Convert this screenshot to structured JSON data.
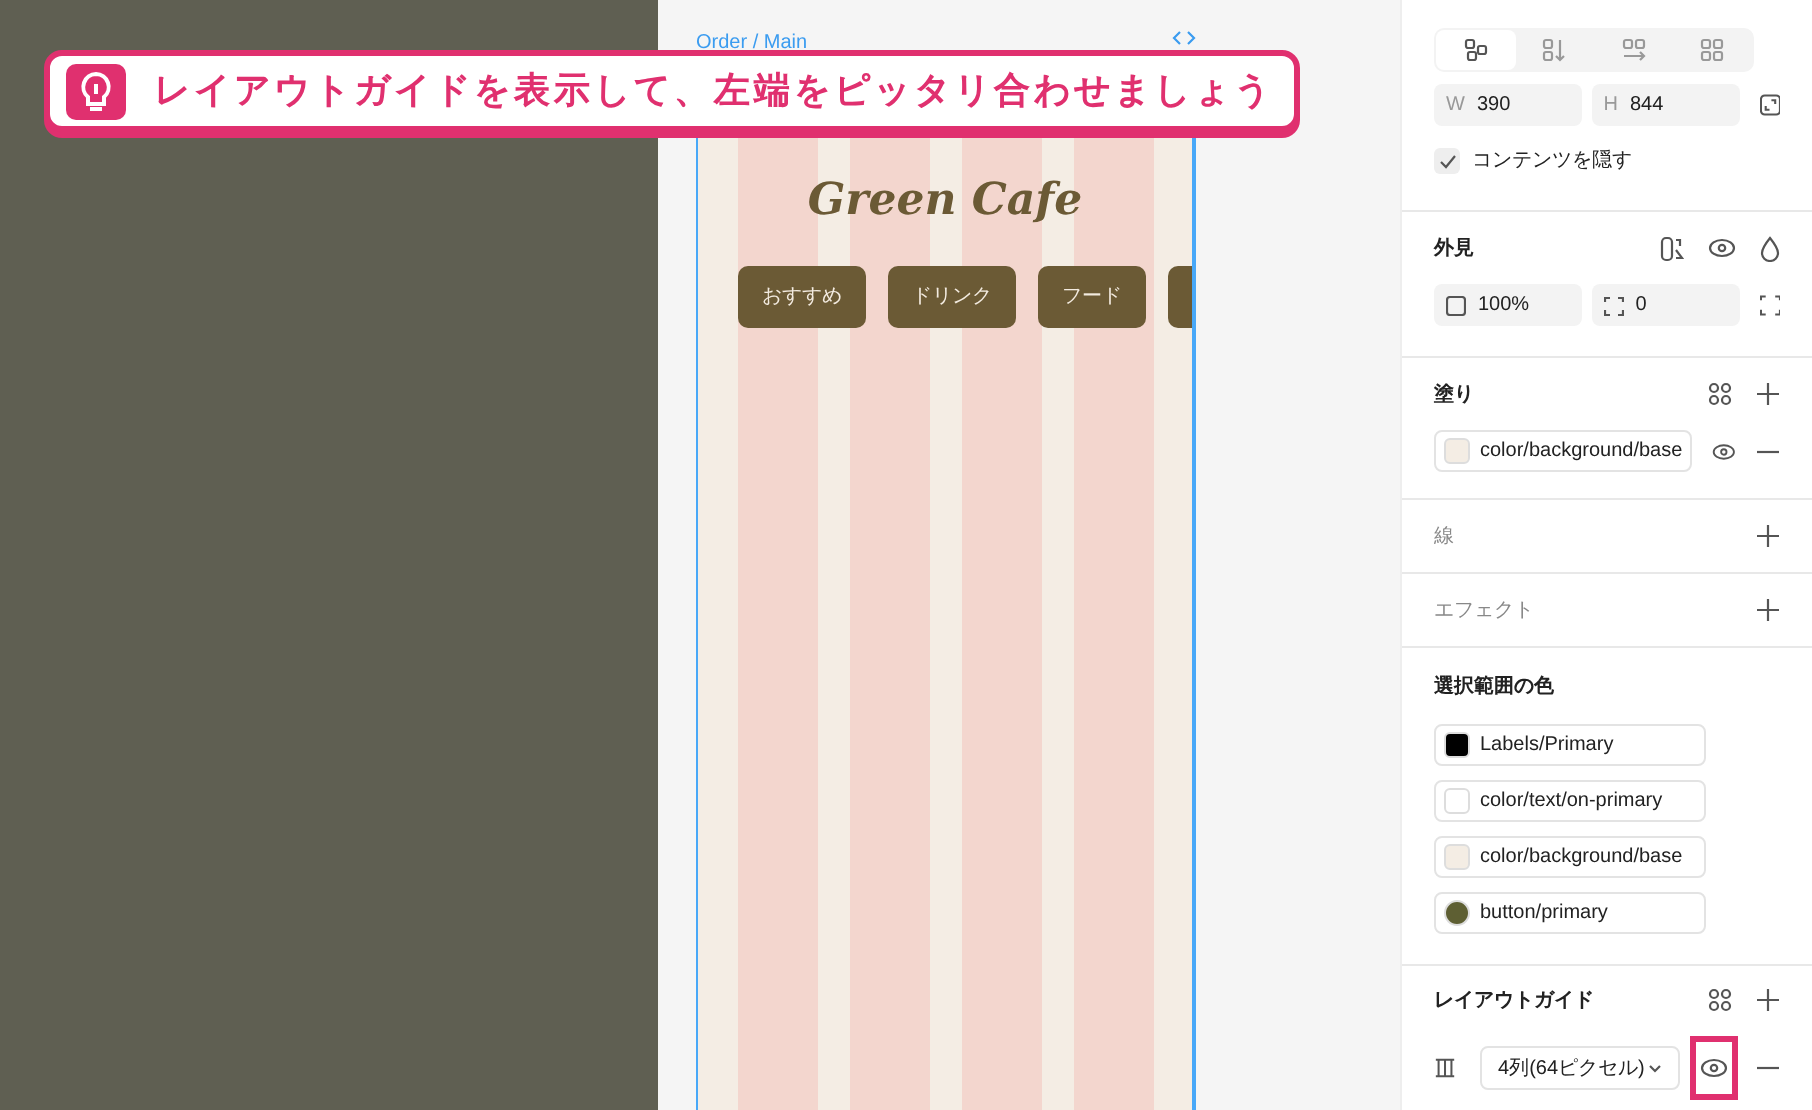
{
  "tip": {
    "text": "レイアウトガイドを表示して、左端をピッタリ合わせましょう"
  },
  "canvas": {
    "frame_label": "Order / Main",
    "logo": "Green Cafe",
    "categories": [
      {
        "kind": "tab",
        "label": "おすすめ"
      },
      {
        "kind": "tab",
        "label": "ドリンク"
      },
      {
        "kind": "tab",
        "label": "フード"
      },
      {
        "kind": "cut"
      }
    ]
  },
  "panel": {
    "alignment_tabs": [
      {
        "kind": "free",
        "selected": true
      },
      {
        "kind": "vertical",
        "selected": false
      },
      {
        "kind": "horizontal",
        "selected": false
      },
      {
        "kind": "grid",
        "selected": false
      }
    ],
    "width": {
      "label": "W",
      "value": "390"
    },
    "height": {
      "label": "H",
      "value": "844"
    },
    "clip": {
      "label": "コンテンツを隠す",
      "checked": true
    },
    "appearance": {
      "title": "外見",
      "opacity": "100%",
      "radius": "0"
    },
    "fill": {
      "title": "塗り",
      "name": "color/background/base",
      "color": "#f4ede4",
      "visible": true
    },
    "stroke": {
      "title": "線"
    },
    "effect": {
      "title": "エフェクト"
    },
    "selection_colors": {
      "title": "選択範囲の色",
      "items": [
        {
          "name": "Labels/Primary",
          "color": "#000000",
          "kind": "square"
        },
        {
          "name": "color/text/on-primary",
          "color": "#ffffff",
          "kind": "square"
        },
        {
          "name": "color/background/base",
          "color": "#f4ede4",
          "kind": "square"
        },
        {
          "name": "button/primary",
          "color": "#5e5f33",
          "kind": "circle"
        }
      ]
    },
    "layout_guide": {
      "title": "レイアウトガイド",
      "value": "4列(64ピクセル)",
      "visible": true,
      "highlighted": true
    }
  }
}
